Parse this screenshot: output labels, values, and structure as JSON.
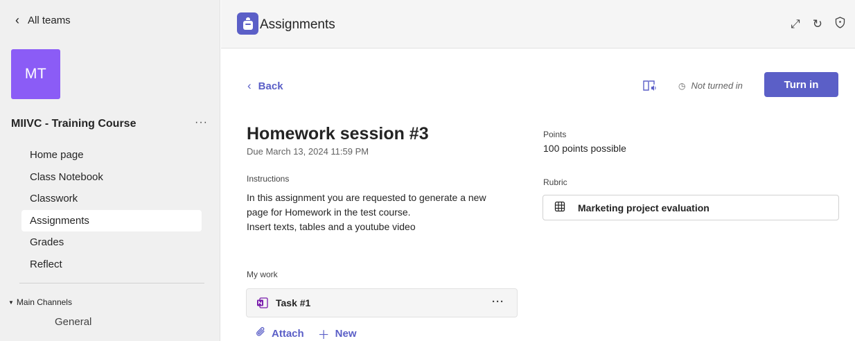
{
  "sidebar": {
    "back_label": "All teams",
    "team_initials": "MT",
    "team_name": "MIIVC - Training Course",
    "more": "···",
    "items": [
      {
        "label": "Home page"
      },
      {
        "label": "Class Notebook"
      },
      {
        "label": "Classwork"
      },
      {
        "label": "Assignments",
        "active": true
      },
      {
        "label": "Grades"
      },
      {
        "label": "Reflect"
      }
    ],
    "channels_heading": "Main Channels",
    "channels": [
      {
        "label": "General"
      }
    ]
  },
  "header": {
    "app_title": "Assignments",
    "icons": [
      "expand-icon",
      "refresh-icon",
      "shield-icon"
    ]
  },
  "assignment": {
    "back_label": "Back",
    "status": "Not turned in",
    "turn_in_label": "Turn in",
    "title": "Homework session #3",
    "due": "Due March 13, 2024 11:59 PM",
    "instructions_label": "Instructions",
    "instructions_lines": [
      "In this assignment you are requested to generate a new",
      "page for Homework in the test course.",
      "Insert texts, tables and a youtube video"
    ],
    "points_label": "Points",
    "points_value": "100 points possible",
    "rubric_label": "Rubric",
    "rubric_name": "Marketing project evaluation",
    "my_work_label": "My work",
    "task_name": "Task #1",
    "task_more": "···",
    "attach_label": "Attach",
    "new_label": "New"
  },
  "colors": {
    "accent": "#5b5fc7",
    "avatar": "#8b5cf6",
    "onenote": "#7719aa"
  }
}
